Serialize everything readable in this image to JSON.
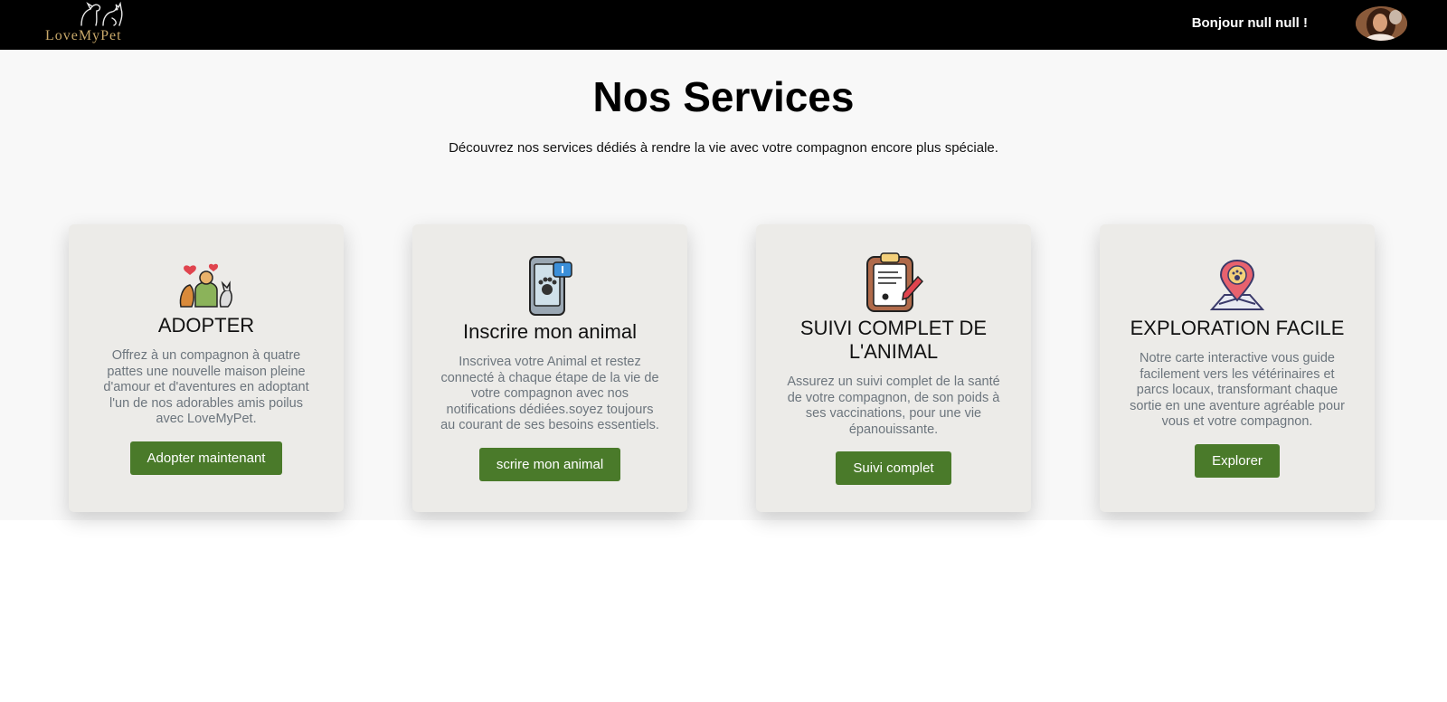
{
  "header": {
    "logo_text": "LoveMyPet",
    "greeting": "Bonjour null null !"
  },
  "main": {
    "title": "Nos Services",
    "subtitle": "Découvrez nos services dédiés à rendre la vie avec votre compagnon encore plus spéciale."
  },
  "cards": [
    {
      "icon": "pet-love-icon",
      "title": "ADOPTER",
      "text": "Offrez à un compagnon à quatre pattes une nouvelle maison pleine d'amour et d'aventures en adoptant l'un de nos adorables amis poilus avec LoveMyPet.",
      "button": "Adopter maintenant"
    },
    {
      "icon": "phone-paw-icon",
      "title": "Inscrire mon animal",
      "text": "Inscrivea votre Animal et restez connecté à chaque étape de la vie de votre compagnon avec nos notifications dédiées.soyez toujours au courant de ses besoins essentiels.",
      "button": "scrire mon animal"
    },
    {
      "icon": "clipboard-paw-icon",
      "title": "SUIVI COMPLET DE L'ANIMAL",
      "text": "Assurez un suivi complet de la santé de votre compagnon, de son poids à ses vaccinations, pour une vie épanouissante.",
      "button": "Suivi complet"
    },
    {
      "icon": "map-pin-paw-icon",
      "title": "EXPLORATION FACILE",
      "text": "Notre carte interactive vous guide facilement vers les vétérinaires et parcs locaux, transformant chaque sortie en une aventure agréable pour vous et votre compagnon.",
      "button": "Explorer"
    }
  ],
  "colors": {
    "header_bg": "#000000",
    "section_bg": "#f8f8f8",
    "card_bg": "#ecebe8",
    "button_bg": "#4a7a2a",
    "logo_gold": "#c9a96a"
  }
}
